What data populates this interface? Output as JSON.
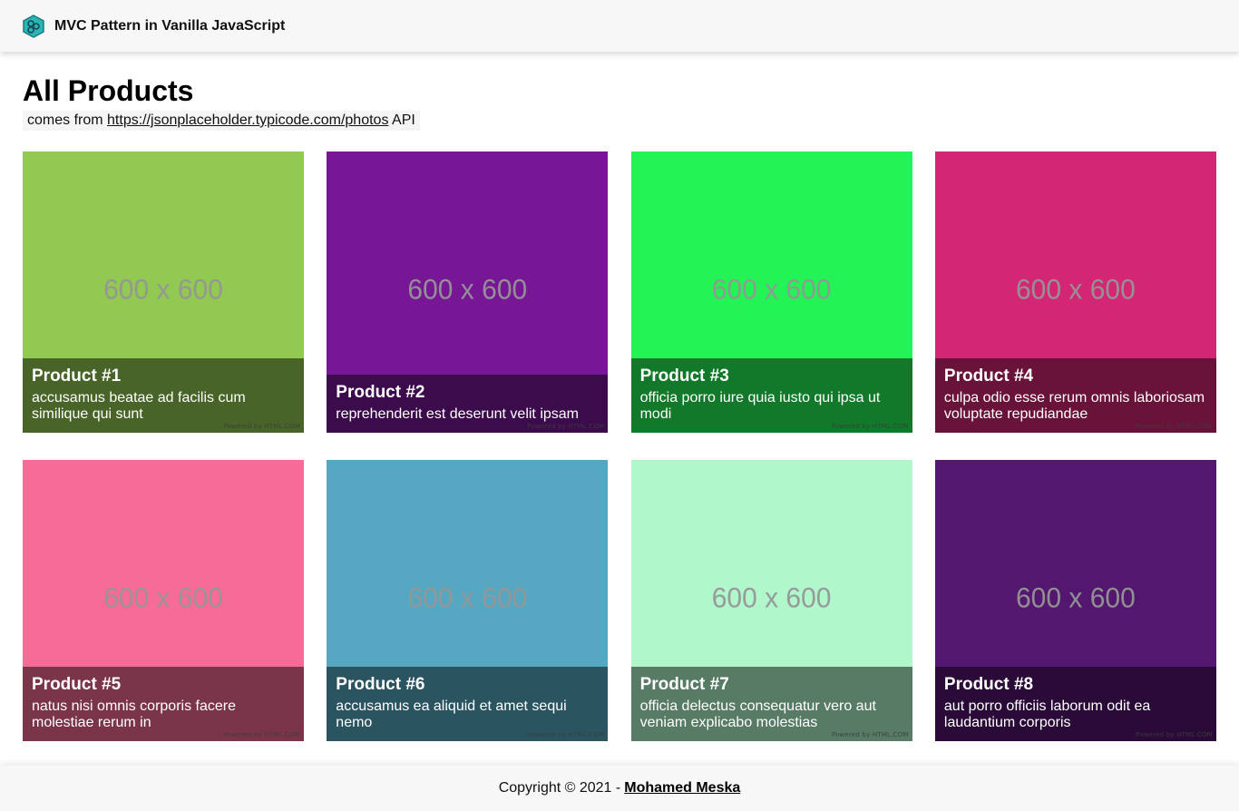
{
  "header": {
    "title": "MVC Pattern in Vanilla JavaScript",
    "logo_icon": "hexagon-logo-icon"
  },
  "main": {
    "title": "All Products",
    "source_prefix": "comes from",
    "source_link": "https://jsonplaceholder.typicode.com/photos",
    "source_suffix": "API"
  },
  "products": [
    {
      "title": "Product #1",
      "description": "accusamus beatae ad facilis cum similique qui sunt",
      "image_text": "600 x 600",
      "color": "#92c952",
      "powered": "Powered by HTML.COM"
    },
    {
      "title": "Product #2",
      "description": "reprehenderit est deserunt velit ipsam",
      "image_text": "600 x 600",
      "color": "#771796",
      "powered": "Powered by HTML.COM"
    },
    {
      "title": "Product #3",
      "description": "officia porro iure quia iusto qui ipsa ut modi",
      "image_text": "600 x 600",
      "color": "#24f355",
      "powered": "Powered by HTML.COM"
    },
    {
      "title": "Product #4",
      "description": "culpa odio esse rerum omnis laboriosam voluptate repudiandae",
      "image_text": "600 x 600",
      "color": "#d32776",
      "powered": "Powered by HTML.COM"
    },
    {
      "title": "Product #5",
      "description": "natus nisi omnis corporis facere molestiae rerum in",
      "image_text": "600 x 600",
      "color": "#f66b97",
      "powered": "Powered by HTML.COM"
    },
    {
      "title": "Product #6",
      "description": "accusamus ea aliquid et amet sequi nemo",
      "image_text": "600 x 600",
      "color": "#56a8c2",
      "powered": "Powered by HTML.COM"
    },
    {
      "title": "Product #7",
      "description": "officia delectus consequatur vero aut veniam explicabo molestias",
      "image_text": "600 x 600",
      "color": "#b0f7cc",
      "powered": "Powered by HTML.COM"
    },
    {
      "title": "Product #8",
      "description": "aut porro officiis laborum odit ea laudantium corporis",
      "image_text": "600 x 600",
      "color": "#54176f",
      "powered": "Powered by HTML.COM"
    }
  ],
  "footer": {
    "copyright": "Copyright © 2021 -",
    "author": "Mohamed Meska"
  }
}
